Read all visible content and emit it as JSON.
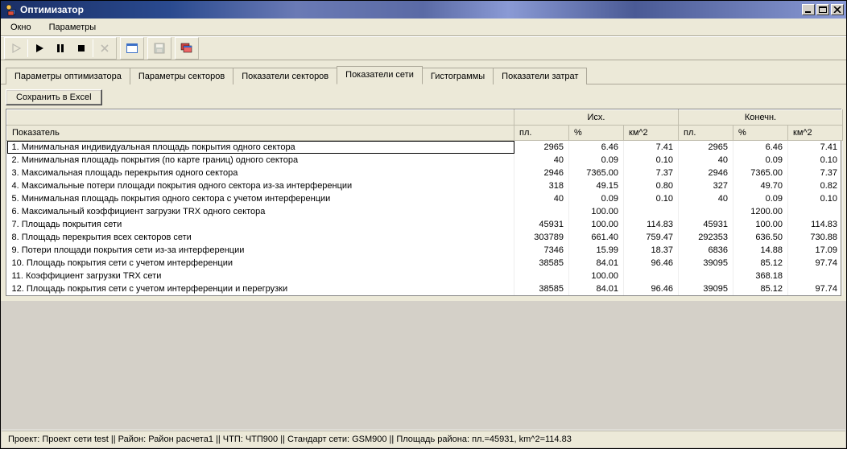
{
  "window": {
    "title": "Оптимизатор"
  },
  "menu": {
    "window": "Окно",
    "params": "Параметры"
  },
  "tabs": {
    "t1": "Параметры оптимизатора",
    "t2": "Параметры секторов",
    "t3": "Показатели секторов",
    "t4": "Показатели сети",
    "t5": "Гистограммы",
    "t6": "Показатели затрат"
  },
  "buttons": {
    "save_excel": "Сохранить в Excel"
  },
  "table": {
    "group_source": "Исх.",
    "group_final": "Конечн.",
    "header_indicator": "Показатель",
    "header_pl": "пл.",
    "header_pct": "%",
    "header_km2": "км^2",
    "rows": [
      {
        "label": "1. Минимальная индивидуальная площадь покрытия одного сектора",
        "s_pl": "2965",
        "s_pct": "6.46",
        "s_km2": "7.41",
        "f_pl": "2965",
        "f_pct": "6.46",
        "f_km2": "7.41"
      },
      {
        "label": "2. Минимальная площадь покрытия (по карте границ) одного сектора",
        "s_pl": "40",
        "s_pct": "0.09",
        "s_km2": "0.10",
        "f_pl": "40",
        "f_pct": "0.09",
        "f_km2": "0.10"
      },
      {
        "label": "3. Максимальная площадь перекрытия одного сектора",
        "s_pl": "2946",
        "s_pct": "7365.00",
        "s_km2": "7.37",
        "f_pl": "2946",
        "f_pct": "7365.00",
        "f_km2": "7.37"
      },
      {
        "label": "4. Максимальные потери площади покрытия одного сектора из-за интерференции",
        "s_pl": "318",
        "s_pct": "49.15",
        "s_km2": "0.80",
        "f_pl": "327",
        "f_pct": "49.70",
        "f_km2": "0.82"
      },
      {
        "label": "5. Минимальная площадь покрытия одного сектора с учетом интерференции",
        "s_pl": "40",
        "s_pct": "0.09",
        "s_km2": "0.10",
        "f_pl": "40",
        "f_pct": "0.09",
        "f_km2": "0.10"
      },
      {
        "label": "6. Максимальный коэффициент загрузки TRX одного сектора",
        "s_pl": "",
        "s_pct": "100.00",
        "s_km2": "",
        "f_pl": "",
        "f_pct": "1200.00",
        "f_km2": ""
      },
      {
        "label": "7. Площадь покрытия сети",
        "s_pl": "45931",
        "s_pct": "100.00",
        "s_km2": "114.83",
        "f_pl": "45931",
        "f_pct": "100.00",
        "f_km2": "114.83"
      },
      {
        "label": "8. Площадь перекрытия всех секторов сети",
        "s_pl": "303789",
        "s_pct": "661.40",
        "s_km2": "759.47",
        "f_pl": "292353",
        "f_pct": "636.50",
        "f_km2": "730.88"
      },
      {
        "label": "9. Потери площади покрытия сети из-за интерференции",
        "s_pl": "7346",
        "s_pct": "15.99",
        "s_km2": "18.37",
        "f_pl": "6836",
        "f_pct": "14.88",
        "f_km2": "17.09"
      },
      {
        "label": "10. Площадь покрытия сети с учетом интерференции",
        "s_pl": "38585",
        "s_pct": "84.01",
        "s_km2": "96.46",
        "f_pl": "39095",
        "f_pct": "85.12",
        "f_km2": "97.74"
      },
      {
        "label": "11. Коэффициент загрузки TRX сети",
        "s_pl": "",
        "s_pct": "100.00",
        "s_km2": "",
        "f_pl": "",
        "f_pct": "368.18",
        "f_km2": ""
      },
      {
        "label": "12. Площадь покрытия сети с учетом интерференции и перегрузки",
        "s_pl": "38585",
        "s_pct": "84.01",
        "s_km2": "96.46",
        "f_pl": "39095",
        "f_pct": "85.12",
        "f_km2": "97.74"
      }
    ]
  },
  "status": {
    "text": "Проект: Проект сети test  ||  Район: Район расчета1  ||  ЧТП: ЧТП900  ||  Стандарт сети: GSM900  ||  Площадь района: пл.=45931, km^2=114.83"
  }
}
